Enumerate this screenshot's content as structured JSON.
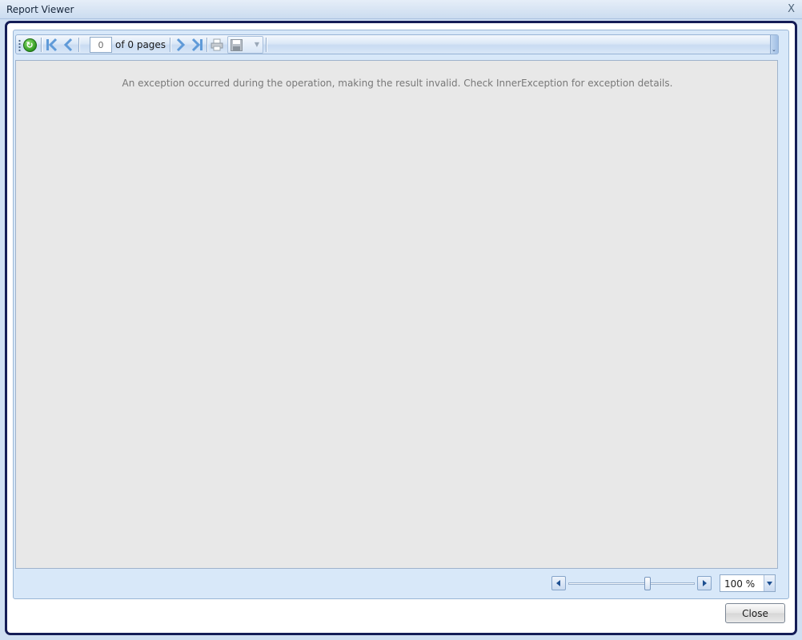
{
  "window": {
    "title": "Report Viewer",
    "close_glyph": "X"
  },
  "toolbar": {
    "icons": {
      "grip": "toolbar-grip-icon",
      "refresh": "refresh-icon",
      "first": "first-page-icon",
      "previous": "previous-page-icon",
      "next": "next-page-icon",
      "last": "last-page-icon",
      "print": "print-icon",
      "export": "save-export-icon",
      "export_caret": "chevron-down-icon"
    },
    "current_page": "0",
    "page_of_label": "of 0 pages",
    "export_caret_glyph": "▼",
    "overflow_glyph": "⌄"
  },
  "report": {
    "message": "An exception occurred during the operation, making the result invalid.  Check InnerException for exception details."
  },
  "zoom": {
    "value_label": "100 %",
    "slider_fraction": 0.63
  },
  "footer": {
    "close_label": "Close"
  },
  "colors": {
    "accent_green": "#2f9a20",
    "nav_blue": "#5f9ad8",
    "frame_navy": "#141c56",
    "panel_blue": "#d8e8f9"
  }
}
